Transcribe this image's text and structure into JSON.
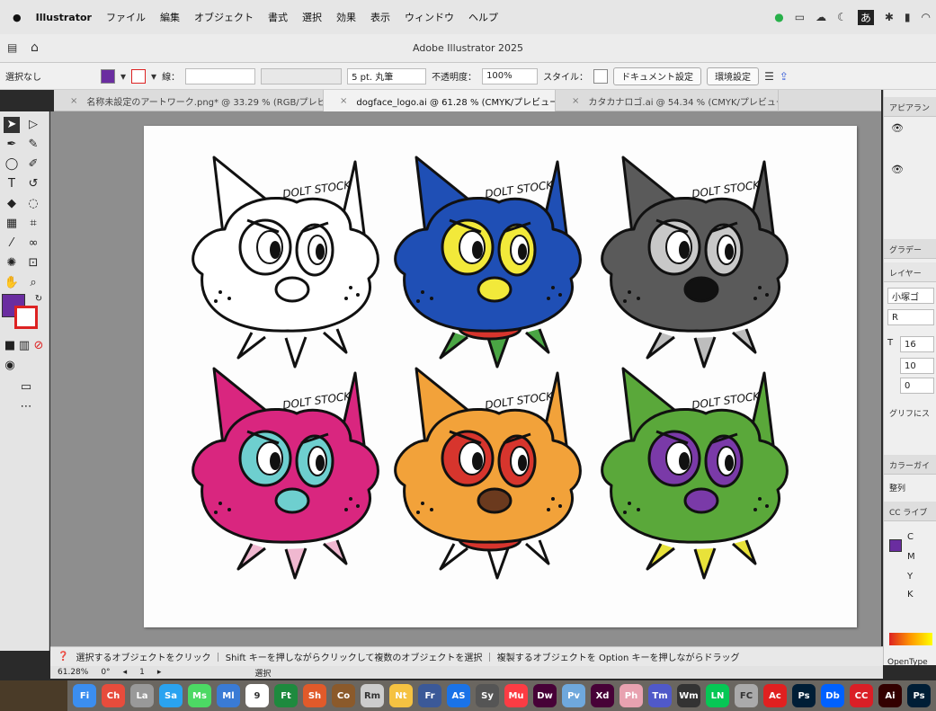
{
  "menubar": {
    "apple": "",
    "app": "Illustrator",
    "items": [
      "ファイル",
      "編集",
      "オブジェクト",
      "書式",
      "選択",
      "効果",
      "表示",
      "ウィンドウ",
      "ヘルプ"
    ]
  },
  "window": {
    "title": "Adobe Illustrator 2025"
  },
  "control": {
    "selection": "選択なし",
    "stroke_label": "線：",
    "brush": "5 pt. 丸筆",
    "opacity_label": "不透明度：",
    "opacity_value": "100%",
    "style_label": "スタイル：",
    "doc_settings": "ドキュメント設定",
    "prefs": "環境設定"
  },
  "tabs": [
    {
      "label": "名称未設定のアートワーク.png* @ 33.29 % (RGB/プレビュー)"
    },
    {
      "label": "dogface_logo.ai @ 61.28 % (CMYK/プレビュー)"
    },
    {
      "label": "カタカナロゴ.ai @ 54.34 % (CMYK/プレビュー)"
    }
  ],
  "artwork": {
    "signature_text": "DOLT STOCK",
    "dogs": [
      {
        "color": "#ffffff",
        "eye": "#ffffff",
        "nose": "#ffffff",
        "spike": "#ffffff"
      },
      {
        "color": "#1f4fb5",
        "eye": "#f2e93a",
        "nose": "#f2e93a",
        "spike": "#4aa544",
        "collar": "#d7352d"
      },
      {
        "color": "#5a5a5a",
        "eye": "#c8c8c8",
        "nose": "#111111",
        "spike": "#bdbdbd"
      },
      {
        "color": "#d9267f",
        "eye": "#6ecfcf",
        "nose": "#6ecfcf",
        "spike": "#f0b8d0"
      },
      {
        "color": "#f2a23a",
        "eye": "#d7352d",
        "nose": "#6b3a1e",
        "spike": "#ffffff",
        "collar": "#d7352d"
      },
      {
        "color": "#5aa83a",
        "eye": "#7a3aa8",
        "nose": "#7a3aa8",
        "spike": "#e8e23a"
      }
    ]
  },
  "panel": {
    "appearance": "アピアラン",
    "gradient": "グラデー",
    "layers": "レイヤー",
    "font": "小塚ゴ",
    "style": "R",
    "size1": "16",
    "size2": "10",
    "size3": "0",
    "glyph": "グリフにス",
    "color_guide": "カラーガイ",
    "sort": "整列",
    "cc_lib": "CC ライブ",
    "cmyk": [
      "C",
      "M",
      "Y",
      "K"
    ],
    "opentype": "OpenType"
  },
  "status": {
    "hint": "選択するオブジェクトをクリック ｜ Shift キーを押しながらクリックして複数のオブジェクトを選択 ｜ 複製するオブジェクトを Option キーを押しながらドラッグ",
    "zoom": "61.28%",
    "angle": "0°",
    "artboard": "1",
    "mode": "選択"
  },
  "dock": [
    "Fi",
    "Ch",
    "La",
    "Sa",
    "Ms",
    "Ml",
    "9",
    "Ft",
    "Sh",
    "Co",
    "Rm",
    "Nt",
    "Fr",
    "AS",
    "Sy",
    "Mu",
    "Dw",
    "Pv",
    "Xd",
    "Ph",
    "Tm",
    "Wm",
    "LN",
    "FC",
    "Ac",
    "Ps",
    "Db",
    "CC",
    "Ai",
    "Ps"
  ]
}
